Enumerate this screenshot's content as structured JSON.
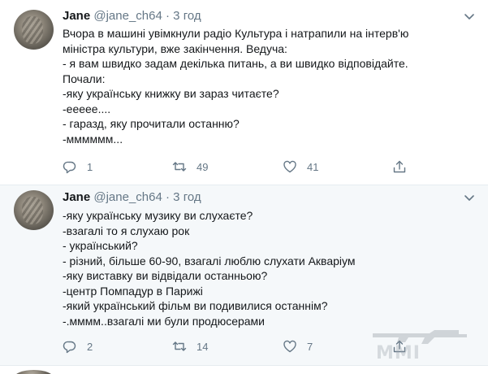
{
  "tweets": [
    {
      "author": "Jane",
      "handle": "@jane_ch64",
      "time": "· 3 год",
      "lines": [
        "Вчора в машині увімкнули радіо Культура і натрапили на інтерв'ю",
        "міністра культури, вже закінчення. Ведуча:",
        "- я вам швидко задам декілька питань, а ви швидко відповідайте.",
        "Почали:",
        "-яку українську книжку ви зараз читаєте?",
        "-ееееe....",
        "- гаразд, яку прочитали останню?",
        "-мммммм..."
      ],
      "replies": "1",
      "retweets": "49",
      "likes": "41"
    },
    {
      "author": "Jane",
      "handle": "@jane_ch64",
      "time": "· 3 год",
      "lines": [
        "-яку українську музику ви слухаєте?",
        "-взагалі то я слухаю рок",
        "- український?",
        "- різний, більше 60-90, взагалі люблю слухати  Акваріум",
        "-яку виставку ви відвідали останньою?",
        "-центр Помпадур в Парижі",
        "-який український фільм ви подивилися останнім?",
        "-.мммм..взагалі ми були продюсерами"
      ],
      "replies": "2",
      "retweets": "14",
      "likes": "7"
    }
  ],
  "watermark": "MMI",
  "colors": {
    "muted": "#657786",
    "text": "#14171a",
    "divider": "#e6ecf0"
  },
  "icons": [
    "reply-icon",
    "retweet-icon",
    "like-icon",
    "share-icon",
    "chevron-down-icon"
  ]
}
